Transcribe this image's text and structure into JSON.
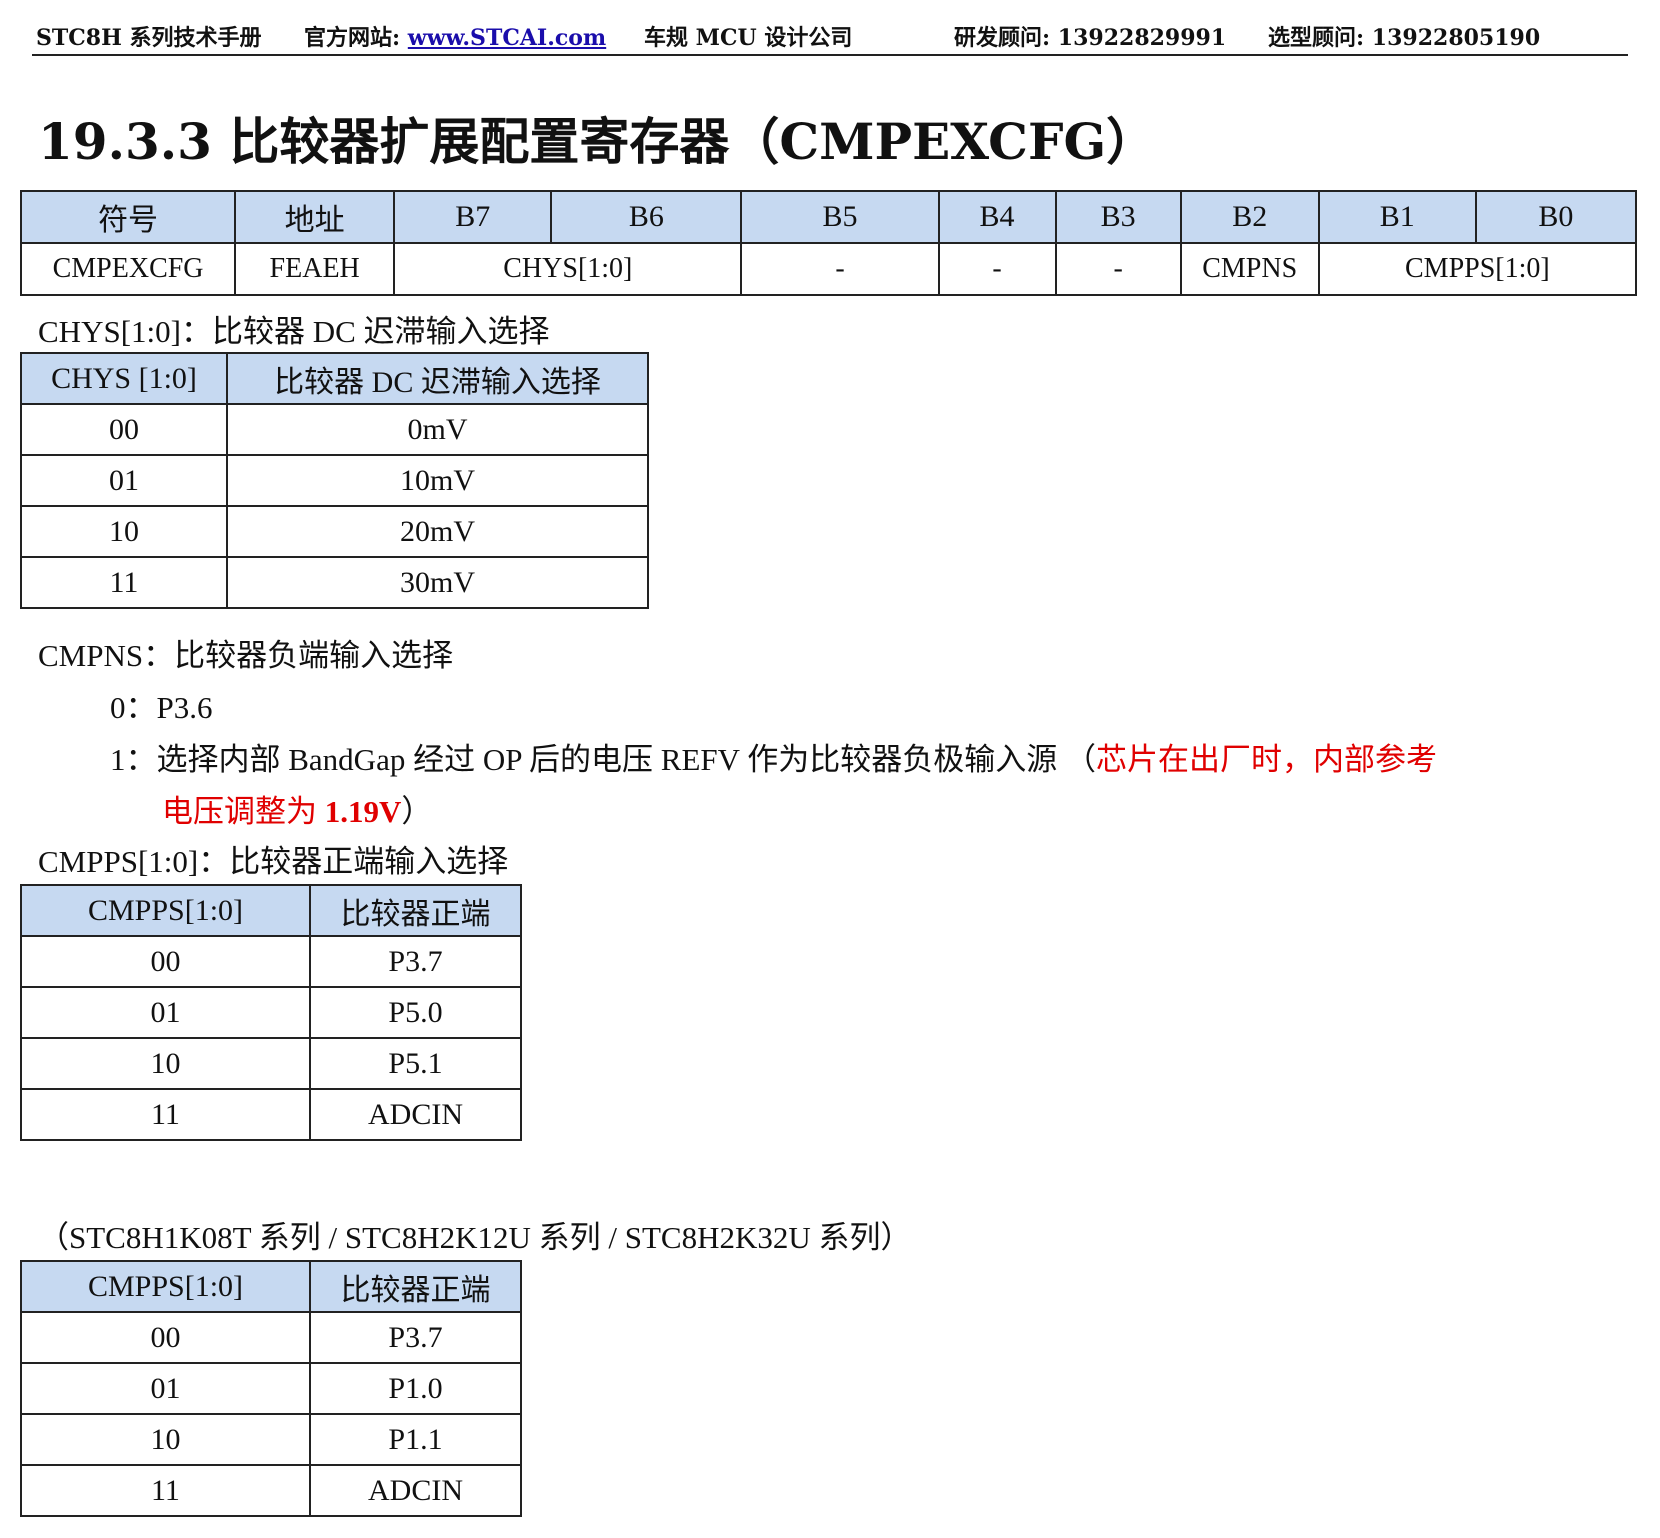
{
  "header": {
    "manual": "STC8H 系列技术手册",
    "site_label": "官方网站:",
    "site_url": "www.STCAI.com",
    "company": "车规 MCU 设计公司",
    "rd_contact": "研发顾问: 13922829991",
    "sel_contact": "选型顾问: 13922805190"
  },
  "title": "19.3.3  比较器扩展配置寄存器（CMPEXCFG）",
  "register": {
    "headers": [
      "符号",
      "地址",
      "B7",
      "B6",
      "B5",
      "B4",
      "B3",
      "B2",
      "B1",
      "B0"
    ],
    "name": "CMPEXCFG",
    "address": "FEAEH",
    "chys": "CHYS[1:0]",
    "b5": "-",
    "b4": "-",
    "b3": "-",
    "b2": "CMPNS",
    "cmpps": "CMPPS[1:0]"
  },
  "chys": {
    "desc": "CHYS[1:0]：比较器 DC 迟滞输入选择",
    "headers": [
      "CHYS [1:0]",
      "比较器 DC 迟滞输入选择"
    ],
    "rows": [
      [
        "00",
        "0mV"
      ],
      [
        "01",
        "10mV"
      ],
      [
        "10",
        "20mV"
      ],
      [
        "11",
        "30mV"
      ]
    ]
  },
  "cmpns": {
    "desc": "CMPNS：比较器负端输入选择",
    "item0": "0：P3.6",
    "item1_label": "1：",
    "item1_text": "选择内部 BandGap 经过 OP 后的电压 REFV 作为比较器负极输入源 （",
    "item1_red": "芯片在出厂时，内部参考",
    "item1_red2": "电压调整为 ",
    "item1_bold": "1.19V",
    "item1_end": "）"
  },
  "cmpps": {
    "desc": "CMPPS[1:0]：比较器正端输入选择",
    "headers": [
      "CMPPS[1:0]",
      "比较器正端"
    ],
    "rows": [
      [
        "00",
        "P3.7"
      ],
      [
        "01",
        "P5.0"
      ],
      [
        "10",
        "P5.1"
      ],
      [
        "11",
        "ADCIN"
      ]
    ]
  },
  "series_note": "（STC8H1K08T 系列 / STC8H2K12U 系列 / STC8H2K32U 系列）",
  "cmpps2": {
    "headers": [
      "CMPPS[1:0]",
      "比较器正端"
    ],
    "rows": [
      [
        "00",
        "P3.7"
      ],
      [
        "01",
        "P1.0"
      ],
      [
        "10",
        "P1.1"
      ],
      [
        "11",
        "ADCIN"
      ]
    ]
  }
}
